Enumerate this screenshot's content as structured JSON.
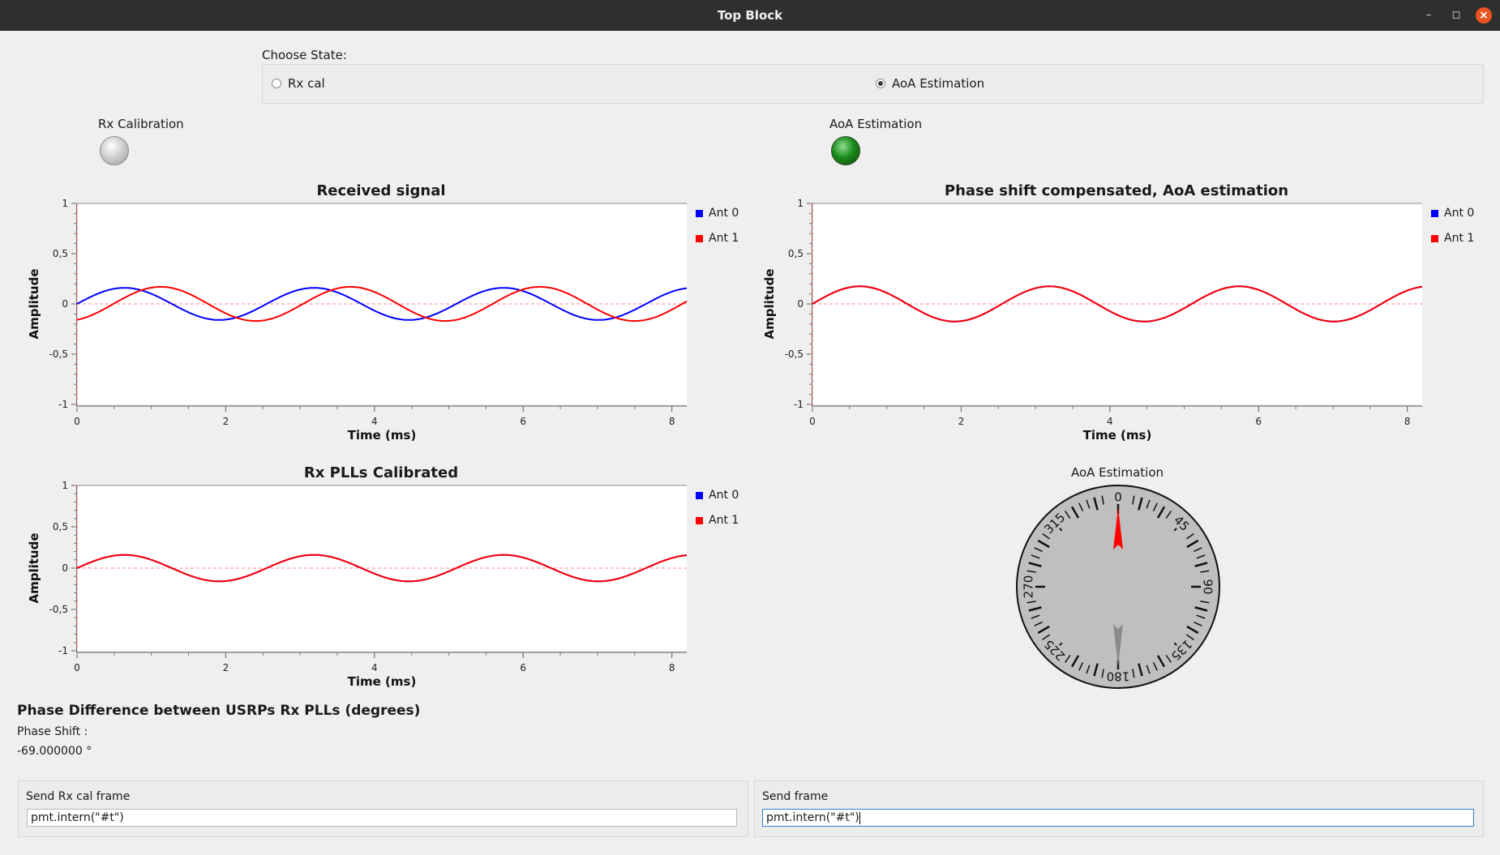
{
  "window": {
    "title": "Top Block",
    "controls": {
      "minimize": "–",
      "maximize": "◻",
      "close": "×"
    }
  },
  "state_chooser": {
    "label": "Choose State:",
    "options": [
      {
        "label": "Rx cal",
        "selected": false
      },
      {
        "label": "AoA Estimation",
        "selected": true
      }
    ]
  },
  "indicators": {
    "rx_cal": {
      "label": "Rx Calibration",
      "state": "off"
    },
    "aoa": {
      "label": "AoA Estimation",
      "state": "on"
    }
  },
  "colors": {
    "ant0": "#0000ff",
    "ant1": "#ff0000",
    "led_on": "#1b8a1b"
  },
  "plots": [
    {
      "id": "received",
      "title": "Received signal",
      "xlabel": "Time (ms)",
      "ylabel": "Amplitude",
      "legend": [
        "Ant 0",
        "Ant 1"
      ]
    },
    {
      "id": "compensated",
      "title": "Phase shift compensated, AoA estimation",
      "xlabel": "Time (ms)",
      "ylabel": "Amplitude",
      "legend": [
        "Ant 0",
        "Ant 1"
      ]
    },
    {
      "id": "calibrated",
      "title": "Rx PLLs Calibrated",
      "xlabel": "Time (ms)",
      "ylabel": "Amplitude",
      "legend": [
        "Ant 0",
        "Ant 1"
      ]
    }
  ],
  "chart_data": [
    {
      "type": "line",
      "title": "Received signal",
      "xlabel": "Time (ms)",
      "ylabel": "Amplitude",
      "xlim": [
        0,
        8.2
      ],
      "ylim": [
        -1,
        1
      ],
      "xticks": [
        0,
        2,
        4,
        6,
        8
      ],
      "yticks": [
        "1",
        "0,5",
        "0",
        "-0,5",
        "-1"
      ],
      "series": [
        {
          "name": "Ant 0",
          "amplitude": 0.16,
          "period_ms": 2.55,
          "phase_deg": 0
        },
        {
          "name": "Ant 1",
          "amplitude": 0.17,
          "period_ms": 2.55,
          "phase_deg": -69
        }
      ]
    },
    {
      "type": "line",
      "title": "Phase shift compensated, AoA estimation",
      "xlabel": "Time (ms)",
      "ylabel": "Amplitude",
      "xlim": [
        0,
        8.2
      ],
      "ylim": [
        -1,
        1
      ],
      "xticks": [
        0,
        2,
        4,
        6,
        8
      ],
      "yticks": [
        "1",
        "0,5",
        "0",
        "-0,5",
        "-1"
      ],
      "series": [
        {
          "name": "Ant 0",
          "amplitude": 0.175,
          "period_ms": 2.55,
          "phase_deg": 0
        },
        {
          "name": "Ant 1",
          "amplitude": 0.175,
          "period_ms": 2.55,
          "phase_deg": 0
        }
      ]
    },
    {
      "type": "line",
      "title": "Rx PLLs Calibrated",
      "xlabel": "Time (ms)",
      "ylabel": "Amplitude",
      "xlim": [
        0,
        8.2
      ],
      "ylim": [
        -1,
        1
      ],
      "xticks": [
        0,
        2,
        4,
        6,
        8
      ],
      "yticks": [
        "1",
        "0,5",
        "0",
        "-0,5",
        "-1"
      ],
      "series": [
        {
          "name": "Ant 0",
          "amplitude": 0.16,
          "period_ms": 2.55,
          "phase_deg": 0
        },
        {
          "name": "Ant 1",
          "amplitude": 0.16,
          "period_ms": 2.55,
          "phase_deg": 0
        }
      ]
    }
  ],
  "compass": {
    "title": "AoA Estimation",
    "labels": [
      "0",
      "45",
      "90",
      "135",
      "180",
      "225",
      "270",
      "315"
    ],
    "needle_deg": 0,
    "needle_color": "#ff0000"
  },
  "phase": {
    "heading": "Phase Difference between USRPs Rx PLLs (degrees)",
    "label": "Phase Shift :",
    "value": "-69.000000 °"
  },
  "message_boxes": [
    {
      "label": "Send Rx cal frame",
      "value": "pmt.intern(\"#t\")"
    },
    {
      "label": "Send frame",
      "value": "pmt.intern(\"#t\")"
    }
  ]
}
